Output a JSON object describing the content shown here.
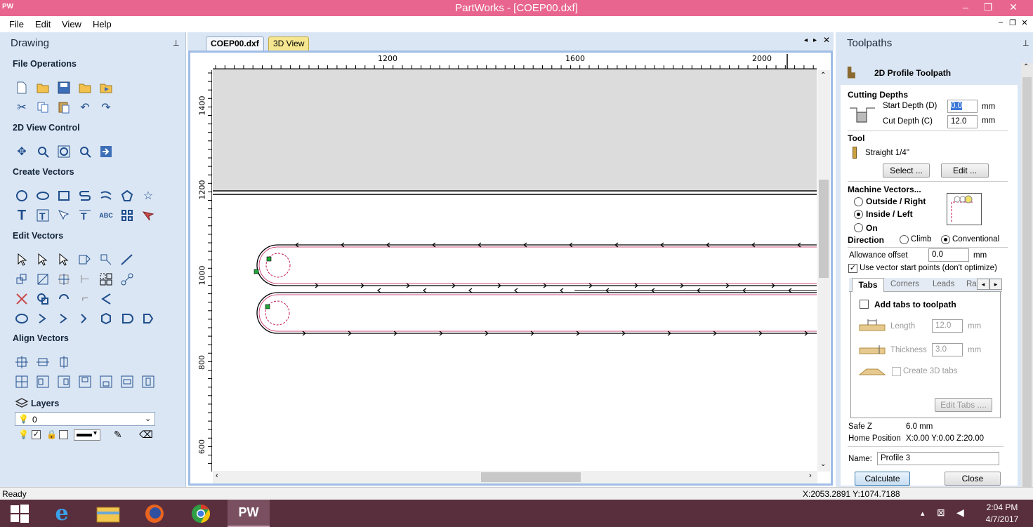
{
  "window": {
    "app_logo": "PW",
    "title": "PartWorks - [COEP00.dxf]",
    "minimize": "–",
    "restore": "❐",
    "close": "✕"
  },
  "menu": {
    "file": "File",
    "edit": "Edit",
    "view": "View",
    "help": "Help"
  },
  "left_panel": {
    "title": "Drawing",
    "pin": "⊥",
    "sections": {
      "file_operations": "File Operations",
      "view_control": "2D View Control",
      "create_vectors": "Create Vectors",
      "edit_vectors": "Edit Vectors",
      "align_vectors": "Align Vectors",
      "layers": "Layers"
    },
    "layer_select": "0"
  },
  "doc_tabs": {
    "active": "COEP00.dxf",
    "other": "3D View"
  },
  "ruler": {
    "h_labels": [
      "1200",
      "1600",
      "2000"
    ],
    "v_labels": [
      "1400",
      "1200",
      "1000",
      "800",
      "600"
    ]
  },
  "right_panel": {
    "title": "Toolpaths",
    "header": "2D Profile Toolpath",
    "cutting_depths": "Cutting Depths",
    "start_depth_label": "Start Depth (D)",
    "start_depth_value": "0.0",
    "cut_depth_label": "Cut Depth (C)",
    "cut_depth_value": "12.0",
    "unit": "mm",
    "tool_label": "Tool",
    "tool_name": "Straight 1/4\"",
    "select_btn": "Select ...",
    "edit_btn": "Edit ...",
    "machine_vectors": "Machine Vectors...",
    "outside_right": "Outside / Right",
    "inside_left": "Inside / Left",
    "on": "On",
    "direction": "Direction",
    "climb": "Climb",
    "conventional": "Conventional",
    "allowance_label": "Allowance offset",
    "allowance_value": "0.0",
    "use_start_points": "Use vector start points (don't optimize)",
    "tabs": [
      "Tabs",
      "Corners",
      "Leads",
      "Ra"
    ],
    "add_tabs": "Add tabs to toolpath",
    "length_label": "Length",
    "length_value": "12.0",
    "thickness_label": "Thickness",
    "thickness_value": "3.0",
    "create_3d_tabs": "Create 3D tabs",
    "edit_tabs_btn": "Edit Tabs ....",
    "safe_z_label": "Safe Z",
    "safe_z_value": "6.0 mm",
    "home_label": "Home Position",
    "home_value": "X:0.00 Y:0.00 Z:20.00",
    "name_label": "Name:",
    "name_value": "Profile 3",
    "calculate_btn": "Calculate",
    "close_btn": "Close"
  },
  "status": {
    "left": "Ready",
    "coords": "X:2053.2891 Y:1074.7188"
  },
  "taskbar": {
    "time": "2:04 PM",
    "date": "4/7/2017",
    "pw_label": "PW"
  },
  "colors": {
    "title_bar": "#e8658f",
    "panel_bg": "#dbe6f4",
    "taskbar": "#5a2f3d",
    "toolpath": "#c2185b"
  }
}
